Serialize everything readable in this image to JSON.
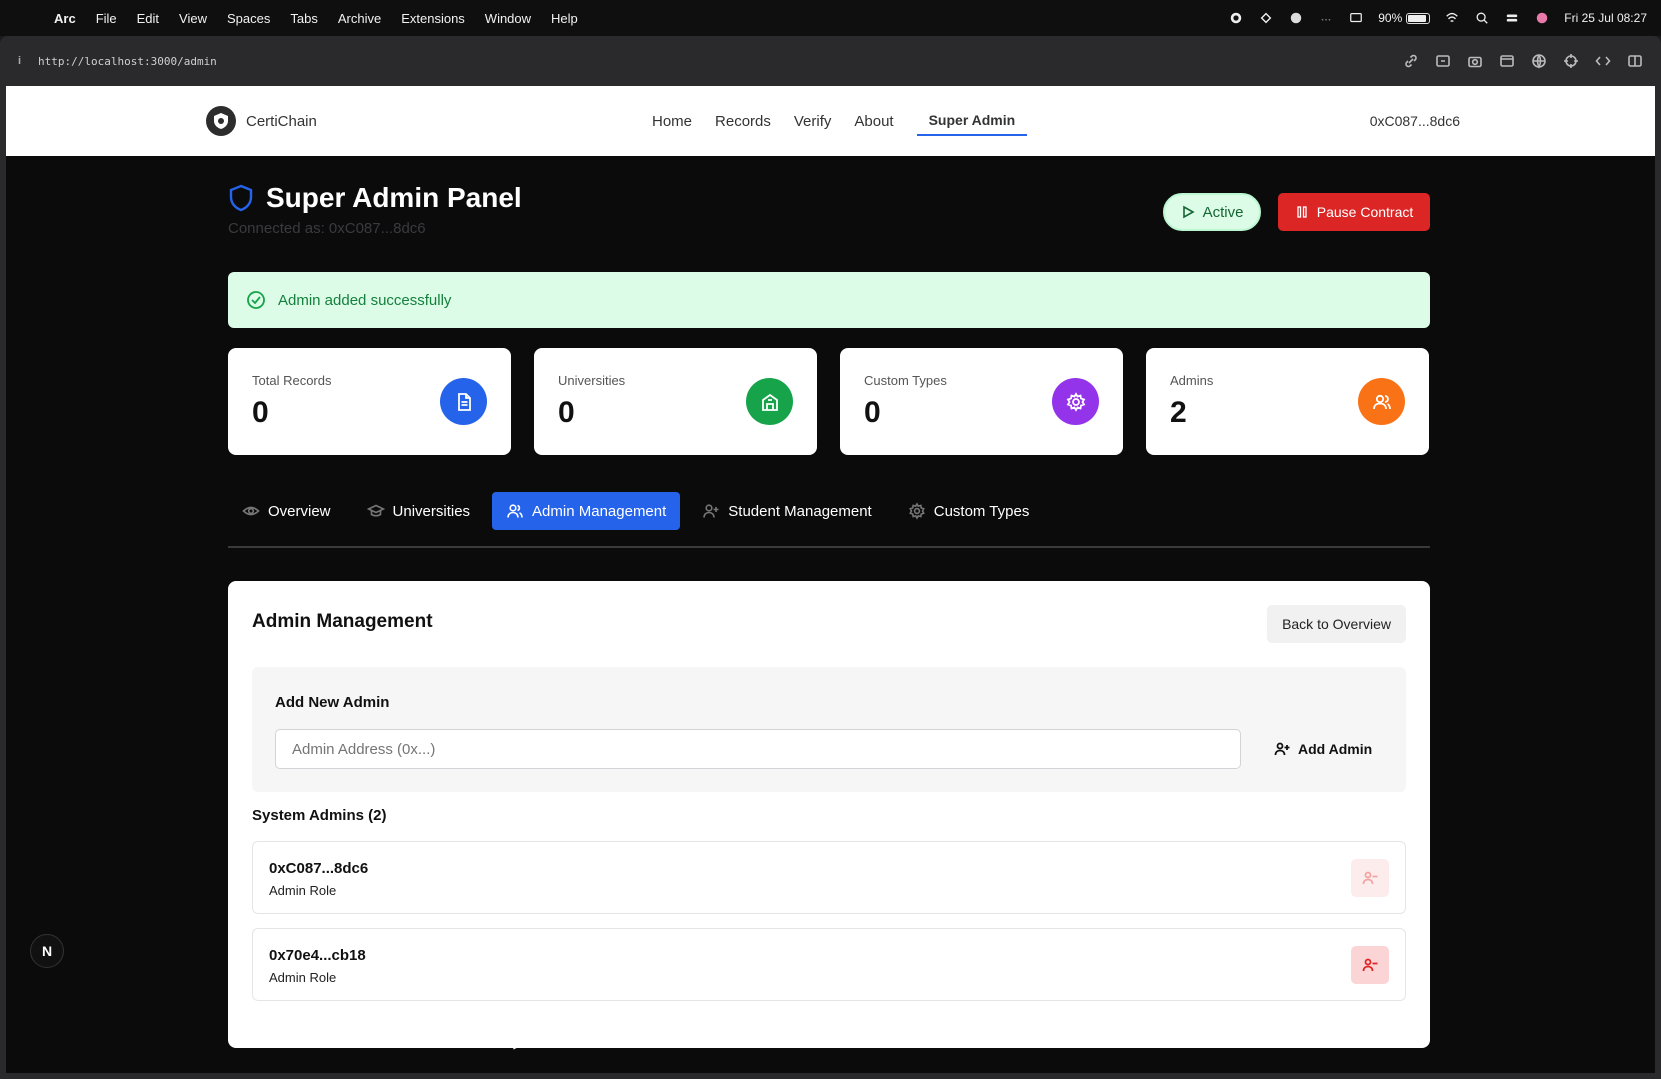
{
  "menubar": {
    "apple": "",
    "items": [
      "Arc",
      "File",
      "Edit",
      "View",
      "Spaces",
      "Tabs",
      "Archive",
      "Extensions",
      "Window",
      "Help"
    ],
    "battery": "90%",
    "battery_level": 0.9,
    "clock": "Fri 25 Jul  08:27"
  },
  "browser": {
    "info_icon": "i",
    "url": "http://localhost:3000/admin"
  },
  "site": {
    "brand": "CertiChain",
    "nav": [
      "Home",
      "Records",
      "Verify",
      "About"
    ],
    "nav_active": "Super Admin",
    "wallet": "0xC087...8dc6"
  },
  "header": {
    "title": "Super Admin Panel",
    "connected": "Connected as: 0xC087...8dc6",
    "status_label": "Active",
    "pause_label": "Pause Contract"
  },
  "alert": {
    "message": "Admin added successfully"
  },
  "stats": [
    {
      "label": "Total Records",
      "value": "0",
      "color": "#2563eb",
      "icon": "document-icon"
    },
    {
      "label": "Universities",
      "value": "0",
      "color": "#16a34a",
      "icon": "building-icon"
    },
    {
      "label": "Custom Types",
      "value": "0",
      "color": "#9333ea",
      "icon": "gear-icon"
    },
    {
      "label": "Admins",
      "value": "2",
      "color": "#f97316",
      "icon": "users-icon"
    }
  ],
  "tabs": [
    "Overview",
    "Universities",
    "Admin Management",
    "Student Management",
    "Custom Types"
  ],
  "panel": {
    "title": "Admin Management",
    "back_label": "Back to Overview",
    "add_title": "Add New Admin",
    "input_placeholder": "Admin Address (0x...)",
    "add_label": "Add Admin",
    "list_title": "System Admins (2)",
    "admins": [
      {
        "address": "0xC087...8dc6",
        "role": "Admin Role"
      },
      {
        "address": "0x70e4...cb18",
        "role": "Admin Role"
      }
    ]
  },
  "dev_badge": "N"
}
